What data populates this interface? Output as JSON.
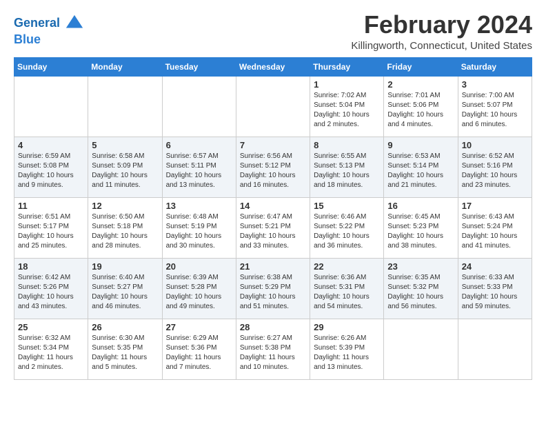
{
  "logo": {
    "line1": "General",
    "line2": "Blue"
  },
  "title": "February 2024",
  "location": "Killingworth, Connecticut, United States",
  "days_of_week": [
    "Sunday",
    "Monday",
    "Tuesday",
    "Wednesday",
    "Thursday",
    "Friday",
    "Saturday"
  ],
  "weeks": [
    [
      {
        "day": "",
        "info": ""
      },
      {
        "day": "",
        "info": ""
      },
      {
        "day": "",
        "info": ""
      },
      {
        "day": "",
        "info": ""
      },
      {
        "day": "1",
        "info": "Sunrise: 7:02 AM\nSunset: 5:04 PM\nDaylight: 10 hours\nand 2 minutes."
      },
      {
        "day": "2",
        "info": "Sunrise: 7:01 AM\nSunset: 5:06 PM\nDaylight: 10 hours\nand 4 minutes."
      },
      {
        "day": "3",
        "info": "Sunrise: 7:00 AM\nSunset: 5:07 PM\nDaylight: 10 hours\nand 6 minutes."
      }
    ],
    [
      {
        "day": "4",
        "info": "Sunrise: 6:59 AM\nSunset: 5:08 PM\nDaylight: 10 hours\nand 9 minutes."
      },
      {
        "day": "5",
        "info": "Sunrise: 6:58 AM\nSunset: 5:09 PM\nDaylight: 10 hours\nand 11 minutes."
      },
      {
        "day": "6",
        "info": "Sunrise: 6:57 AM\nSunset: 5:11 PM\nDaylight: 10 hours\nand 13 minutes."
      },
      {
        "day": "7",
        "info": "Sunrise: 6:56 AM\nSunset: 5:12 PM\nDaylight: 10 hours\nand 16 minutes."
      },
      {
        "day": "8",
        "info": "Sunrise: 6:55 AM\nSunset: 5:13 PM\nDaylight: 10 hours\nand 18 minutes."
      },
      {
        "day": "9",
        "info": "Sunrise: 6:53 AM\nSunset: 5:14 PM\nDaylight: 10 hours\nand 21 minutes."
      },
      {
        "day": "10",
        "info": "Sunrise: 6:52 AM\nSunset: 5:16 PM\nDaylight: 10 hours\nand 23 minutes."
      }
    ],
    [
      {
        "day": "11",
        "info": "Sunrise: 6:51 AM\nSunset: 5:17 PM\nDaylight: 10 hours\nand 25 minutes."
      },
      {
        "day": "12",
        "info": "Sunrise: 6:50 AM\nSunset: 5:18 PM\nDaylight: 10 hours\nand 28 minutes."
      },
      {
        "day": "13",
        "info": "Sunrise: 6:48 AM\nSunset: 5:19 PM\nDaylight: 10 hours\nand 30 minutes."
      },
      {
        "day": "14",
        "info": "Sunrise: 6:47 AM\nSunset: 5:21 PM\nDaylight: 10 hours\nand 33 minutes."
      },
      {
        "day": "15",
        "info": "Sunrise: 6:46 AM\nSunset: 5:22 PM\nDaylight: 10 hours\nand 36 minutes."
      },
      {
        "day": "16",
        "info": "Sunrise: 6:45 AM\nSunset: 5:23 PM\nDaylight: 10 hours\nand 38 minutes."
      },
      {
        "day": "17",
        "info": "Sunrise: 6:43 AM\nSunset: 5:24 PM\nDaylight: 10 hours\nand 41 minutes."
      }
    ],
    [
      {
        "day": "18",
        "info": "Sunrise: 6:42 AM\nSunset: 5:26 PM\nDaylight: 10 hours\nand 43 minutes."
      },
      {
        "day": "19",
        "info": "Sunrise: 6:40 AM\nSunset: 5:27 PM\nDaylight: 10 hours\nand 46 minutes."
      },
      {
        "day": "20",
        "info": "Sunrise: 6:39 AM\nSunset: 5:28 PM\nDaylight: 10 hours\nand 49 minutes."
      },
      {
        "day": "21",
        "info": "Sunrise: 6:38 AM\nSunset: 5:29 PM\nDaylight: 10 hours\nand 51 minutes."
      },
      {
        "day": "22",
        "info": "Sunrise: 6:36 AM\nSunset: 5:31 PM\nDaylight: 10 hours\nand 54 minutes."
      },
      {
        "day": "23",
        "info": "Sunrise: 6:35 AM\nSunset: 5:32 PM\nDaylight: 10 hours\nand 56 minutes."
      },
      {
        "day": "24",
        "info": "Sunrise: 6:33 AM\nSunset: 5:33 PM\nDaylight: 10 hours\nand 59 minutes."
      }
    ],
    [
      {
        "day": "25",
        "info": "Sunrise: 6:32 AM\nSunset: 5:34 PM\nDaylight: 11 hours\nand 2 minutes."
      },
      {
        "day": "26",
        "info": "Sunrise: 6:30 AM\nSunset: 5:35 PM\nDaylight: 11 hours\nand 5 minutes."
      },
      {
        "day": "27",
        "info": "Sunrise: 6:29 AM\nSunset: 5:36 PM\nDaylight: 11 hours\nand 7 minutes."
      },
      {
        "day": "28",
        "info": "Sunrise: 6:27 AM\nSunset: 5:38 PM\nDaylight: 11 hours\nand 10 minutes."
      },
      {
        "day": "29",
        "info": "Sunrise: 6:26 AM\nSunset: 5:39 PM\nDaylight: 11 hours\nand 13 minutes."
      },
      {
        "day": "",
        "info": ""
      },
      {
        "day": "",
        "info": ""
      }
    ]
  ]
}
